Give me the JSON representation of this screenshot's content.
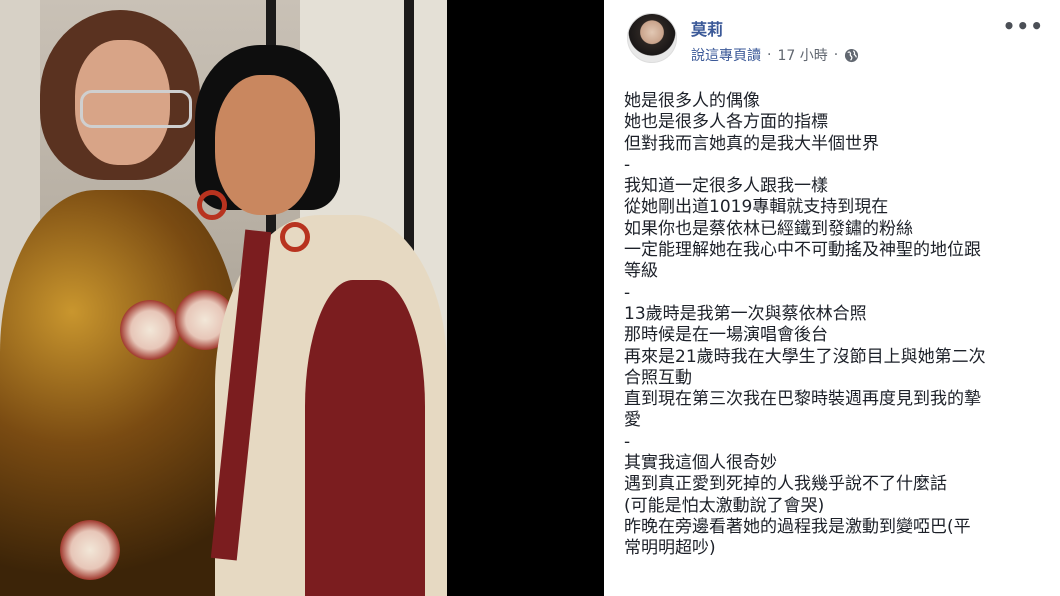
{
  "post": {
    "author_name": "莫莉",
    "meta_source": "說這專頁讀",
    "meta_time": "17 小時",
    "meta_dot1": "·",
    "meta_dot2": "·",
    "privacy_icon": "globe-icon",
    "more_icon": "more-options-icon",
    "body_lines": [
      "她是很多人的偶像",
      "她也是很多人各方面的指標",
      "但對我而言她真的是我大半個世界",
      "-",
      "我知道一定很多人跟我一樣",
      "從她剛出道1019專輯就支持到現在",
      "如果你也是蔡依林已經鐵到發鏽的粉絲",
      "一定能理解她在我心中不可動搖及神聖的地位跟",
      "等級",
      "-",
      "13歲時是我第一次與蔡依林合照",
      "那時候是在一場演唱會後台",
      "再來是21歲時我在大學生了沒節目上與她第二次",
      "合照互動",
      "直到現在第三次我在巴黎時裝週再度見到我的摯",
      "愛",
      "-",
      "其實我這個人很奇妙",
      "遇到真正愛到死掉的人我幾乎說不了什麼話",
      "(可能是怕太激動說了會哭)",
      "昨晚在旁邊看著她的過程我是激動到變啞巴(平",
      "常明明超吵)"
    ]
  },
  "colors": {
    "link": "#3b5998",
    "meta": "#616770",
    "text": "#1d2129"
  }
}
